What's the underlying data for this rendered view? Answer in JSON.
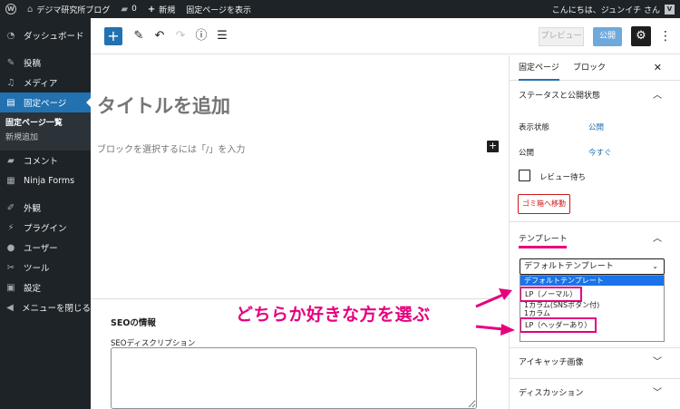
{
  "adminbar": {
    "site_name": "デジマ研究所ブログ",
    "comments_count": "0",
    "new_label": "新規",
    "view_page_label": "固定ページを表示",
    "greeting": "こんにちは、ジュンイチ さん",
    "avatar_letter": "V"
  },
  "sidebar": {
    "items": [
      {
        "label": "ダッシュボード",
        "icon": "dashboard-icon"
      },
      {
        "label": "投稿",
        "icon": "pin-icon"
      },
      {
        "label": "メディア",
        "icon": "media-icon"
      },
      {
        "label": "固定ページ",
        "icon": "page-icon"
      },
      {
        "label": "コメント",
        "icon": "comment-icon"
      },
      {
        "label": "Ninja Forms",
        "icon": "form-icon"
      },
      {
        "label": "外観",
        "icon": "brush-icon"
      },
      {
        "label": "プラグイン",
        "icon": "plugin-icon"
      },
      {
        "label": "ユーザー",
        "icon": "user-icon"
      },
      {
        "label": "ツール",
        "icon": "wrench-icon"
      },
      {
        "label": "設定",
        "icon": "settings-icon"
      },
      {
        "label": "メニューを閉じる",
        "icon": "collapse-icon"
      }
    ],
    "submenu": [
      "固定ページ一覧",
      "新規追加"
    ]
  },
  "toolbar": {
    "preview_label": "プレビュー",
    "publish_label": "公開"
  },
  "editor": {
    "title_placeholder": "タイトルを追加",
    "block_hint": "ブロックを選択するには「/」を入力"
  },
  "seo": {
    "title": "SEOの情報",
    "description_label": "SEOディスクリプション"
  },
  "annotation": {
    "text": "どちらか好きな方を選ぶ",
    "color": "#e6007e"
  },
  "panel": {
    "tabs": [
      "固定ページ",
      "ブロック"
    ],
    "status_section": "ステータスと公開状態",
    "visibility_label": "表示状態",
    "visibility_value": "公開",
    "publish_label": "公開",
    "publish_value": "今すぐ",
    "pending_label": "レビュー待ち",
    "trash_label": "ゴミ箱へ移動",
    "template_section": "テンプレート",
    "template_selected": "デフォルトテンプレート",
    "template_options": [
      "デフォルトテンプレート",
      "LP（ノーマル）",
      "1カラム(SNSボタン付)",
      "1カラム",
      "LP（ヘッダーあり）"
    ],
    "featured_image": "アイキャッチ画像",
    "discussion": "ディスカッション"
  }
}
